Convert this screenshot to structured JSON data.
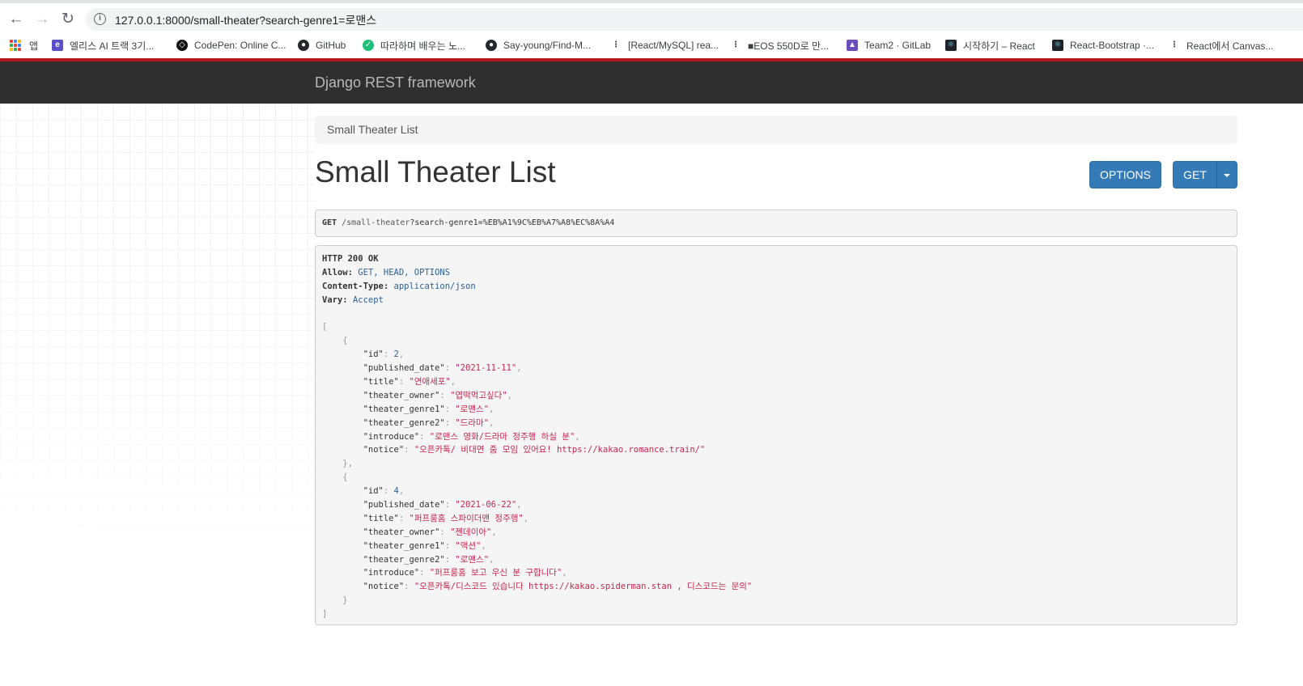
{
  "browser": {
    "url": "127.0.0.1:8000/small-theater?search-genre1=로맨스",
    "bookmarks": [
      {
        "label": "앱",
        "icon": "apps-grid-icon"
      },
      {
        "label": "엘리스 AI 트랙 3기...",
        "icon": "elice-icon"
      },
      {
        "label": "CodePen: Online C...",
        "icon": "codepen-icon"
      },
      {
        "label": "GitHub",
        "icon": "github-icon"
      },
      {
        "label": "따라하며 배우는 노...",
        "icon": "inflearn-icon"
      },
      {
        "label": "Say-young/Find-M...",
        "icon": "github-icon"
      },
      {
        "label": "[React/MySQL] rea...",
        "icon": "velog-icon"
      },
      {
        "label": "■EOS 550D로 만...",
        "icon": "velog-icon"
      },
      {
        "label": "Team2 · GitLab",
        "icon": "gitlab-icon"
      },
      {
        "label": "시작하기 – React",
        "icon": "react-icon"
      },
      {
        "label": "React-Bootstrap ·...",
        "icon": "react-bootstrap-icon"
      },
      {
        "label": "React에서 Canvas...",
        "icon": "velog-icon"
      }
    ]
  },
  "navbar": {
    "brand": "Django REST framework"
  },
  "breadcrumb": {
    "label": "Small Theater List"
  },
  "page": {
    "title": "Small Theater List",
    "options_button": "OPTIONS",
    "get_button": "GET"
  },
  "request": {
    "method": "GET",
    "path": "/small-theater",
    "query": "?search-genre1=%EB%A1%9C%EB%A7%A8%EC%8A%A4"
  },
  "response": {
    "status": "HTTP 200 OK",
    "headers": [
      {
        "name": "Allow:",
        "value": "GET, HEAD, OPTIONS"
      },
      {
        "name": "Content-Type:",
        "value": "application/json"
      },
      {
        "name": "Vary:",
        "value": "Accept"
      }
    ],
    "items": [
      {
        "id": "2",
        "published_date": "\"2021-11-11\"",
        "title": "\"연애세포\"",
        "theater_owner": "\"엽떡먹고싶다\"",
        "theater_genre1": "\"로맨스\"",
        "theater_genre2": "\"드라마\"",
        "introduce": "\"로맨스 영화/드라마 정주행 하실 분\"",
        "notice": "\"오픈카톡/ 비대면 줌 모임 있어요! https://kakao.romance.train/\""
      },
      {
        "id": "4",
        "published_date": "\"2021-06-22\"",
        "title": "\"퍼프룸홈 스파이더맨 정주행\"",
        "theater_owner": "\"젠데이아\"",
        "theater_genre1": "\"액션\"",
        "theater_genre2": "\"로맨스\"",
        "introduce": "\"퍼프룸홈 보고 우신 분 구합니다\"",
        "notice": "\"오픈카톡/디스코드 있습니다 https://kakao.spiderman.stan , 디스코드는 문의\""
      }
    ]
  },
  "colors": {
    "navbar": "#2f2f2f",
    "button": "#337ab7",
    "string": "#c7254e",
    "number": "#2b6196",
    "chrome_accent": "#b5191f"
  }
}
